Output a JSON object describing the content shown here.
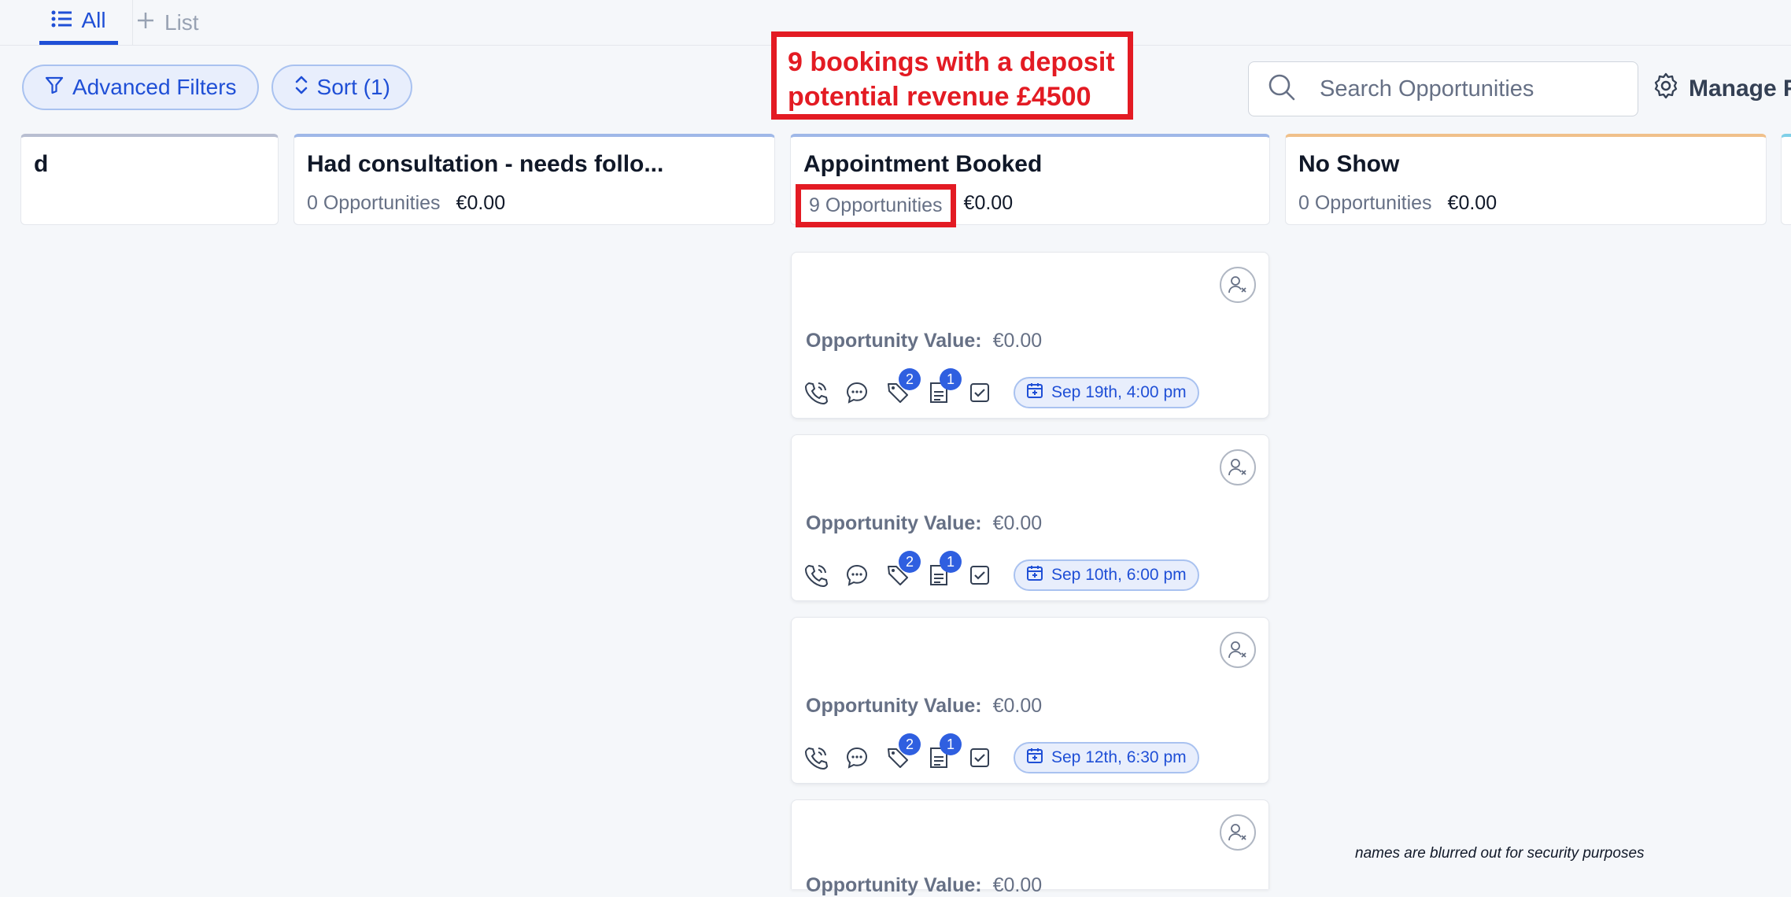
{
  "tabs": [
    {
      "label": "All"
    },
    {
      "label": "List"
    }
  ],
  "toolbar": {
    "advanced_filters_label": "Advanced Filters",
    "sort_label": "Sort (1)"
  },
  "annotation": {
    "line1": "9 bookings with a deposit",
    "line2": "potential revenue £4500"
  },
  "search": {
    "placeholder": "Search Opportunities"
  },
  "manage_label": "Manage F",
  "columns": [
    {
      "title": "d",
      "count": "",
      "amount": ""
    },
    {
      "title": "Had consultation - needs follo...",
      "count": "0 Opportunities",
      "amount": "€0.00"
    },
    {
      "title": "Appointment Booked",
      "count": "9 Opportunities",
      "amount": "€0.00"
    },
    {
      "title": "No Show",
      "count": "0 Opportunities",
      "amount": "€0.00"
    }
  ],
  "cards": [
    {
      "value_label": "Opportunity Value:",
      "value": "€0.00",
      "tags_badge": "2",
      "notes_badge": "1",
      "date": "Sep 19th, 4:00 pm"
    },
    {
      "value_label": "Opportunity Value:",
      "value": "€0.00",
      "tags_badge": "2",
      "notes_badge": "1",
      "date": "Sep 10th, 6:00 pm"
    },
    {
      "value_label": "Opportunity Value:",
      "value": "€0.00",
      "tags_badge": "2",
      "notes_badge": "1",
      "date": "Sep 12th, 6:30 pm"
    },
    {
      "value_label": "Opportunity Value:",
      "value": "€0.00"
    }
  ],
  "footnote": "names are blurred out for security purposes",
  "colors": {
    "accent": "#1f4fd6",
    "badge": "#2f5fe0",
    "annotation_red": "#e31b23"
  },
  "icons": [
    "list-icon",
    "plus-icon",
    "filter-icon",
    "sort-icon",
    "search-icon",
    "gear-icon",
    "user-unassigned-icon",
    "phone-icon",
    "message-icon",
    "tag-icon",
    "notes-icon",
    "checkbox-icon",
    "calendar-icon"
  ]
}
